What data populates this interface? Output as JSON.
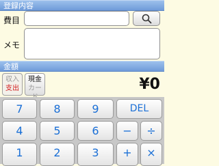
{
  "header_entry": "登録内容",
  "field_cost": {
    "label": "費目",
    "value": ""
  },
  "field_memo": {
    "label": "メモ",
    "value": ""
  },
  "search_icon": "search-icon",
  "header_amount": "金額",
  "toggle_type": {
    "top": "収入",
    "bottom": "支出"
  },
  "toggle_payment": {
    "top": "現金",
    "bottom": "カード"
  },
  "amount": "¥0",
  "keypad": {
    "row1": [
      "7",
      "8",
      "9",
      "DEL"
    ],
    "row2": [
      "4",
      "5",
      "6",
      "−",
      "÷"
    ],
    "row3": [
      "1",
      "2",
      "3",
      "+",
      "×"
    ]
  },
  "colors": {
    "header": "#7aa6e0",
    "background": "#fdfbe3",
    "key_text": "#1a6fd6",
    "expense_text": "#d21c1c"
  }
}
